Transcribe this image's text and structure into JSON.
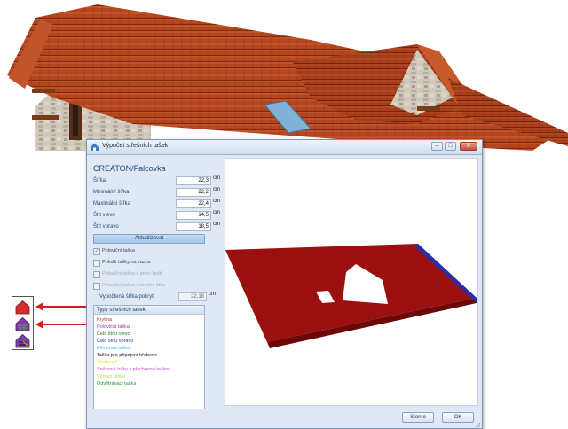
{
  "dialog": {
    "title": "Výpočet střešních tašek",
    "window_buttons": {
      "minimize": "–",
      "maximize": "□",
      "close": "✕"
    },
    "product": "CREATON/Falcovka",
    "fields": [
      {
        "label": "Šířka:",
        "value": "22,3",
        "unit": "cm"
      },
      {
        "label": "Minimální šířka",
        "value": "22,2",
        "unit": "cm"
      },
      {
        "label": "Maximální šířka",
        "value": "22,4",
        "unit": "cm"
      },
      {
        "label": "Štít vlevo",
        "value": "14,5",
        "unit": "cm"
      },
      {
        "label": "Štít vpravo",
        "value": "18,5",
        "unit": "cm"
      }
    ],
    "update_button": "Aktualizovat",
    "checkboxes": [
      {
        "label": "Poloviční taška",
        "checked": true,
        "enabled": true
      },
      {
        "label": "Položit tašky na vazbu",
        "checked": false,
        "enabled": true
      },
      {
        "label": "Poloviční taška v první řadě",
        "checked": false,
        "enabled": false
      },
      {
        "label": "Poloviční taška u levého štítu",
        "checked": false,
        "enabled": false
      }
    ],
    "computed_width": {
      "label": "Vypočtená šířka pokrytí",
      "value": "22,18",
      "unit": "cm"
    },
    "tile_types": {
      "header": "Typy střešních tašek",
      "items": [
        {
          "label": "Krytina",
          "color": "#c0392b"
        },
        {
          "label": "Poloviční taška",
          "color": "#9b2fae"
        },
        {
          "label": "Čelo štítu vlevo",
          "color": "#2a7d2a"
        },
        {
          "label": "Čelo štítu vpravo",
          "color": "#2b3bb0"
        },
        {
          "label": "Plechová taška",
          "color": "#37c6d8"
        },
        {
          "label": "Taška pro připojení hřebene",
          "color": "#1a1a1a"
        },
        {
          "label": "Hřebenáč",
          "color": "#e8e23a"
        },
        {
          "label": "Sněhové háky s plechovou taškou",
          "color": "#c54ccf"
        },
        {
          "label": "Větrací taška",
          "color": "#b5e03c"
        },
        {
          "label": "Odvětrávací taška",
          "color": "#2f8f3a"
        }
      ]
    },
    "buttons": {
      "cancel": "Storno",
      "ok": "OK"
    }
  },
  "colors": {
    "roof_tile": "#b23c18",
    "preview_roof": "#9b0f0f",
    "left_gable": "#2a8a2a",
    "right_gable": "#2a2fa8",
    "accent": "#2b4a7a"
  },
  "side_toolbar": {
    "icons": [
      "roof-red-icon",
      "roof-tiles-icon",
      "roof-tiles-purple-icon"
    ],
    "arrow_color": "#d11f1f"
  }
}
